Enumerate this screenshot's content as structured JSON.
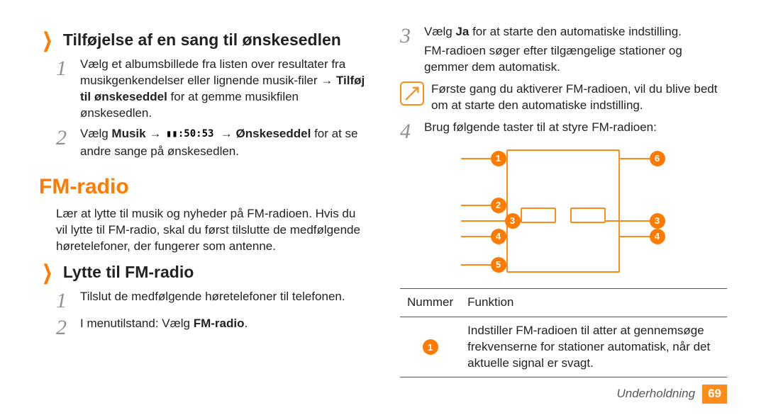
{
  "left": {
    "h2a": "Tilføjelse af en sang til ønskesedlen",
    "step1": "Vælg et albumsbillede fra listen over resultater fra musikgenkendelser eller lignende musik-filer → ",
    "step1_bold": "Tilføj til ønskeseddel",
    "step1_tail": " for at gemme musikfilen ønskesedlen.",
    "step2_pre": "Vælg ",
    "step2_b1": "Musik",
    "step2_mid": " → ",
    "step2_b2": " → Ønskeseddel",
    "step2_tail": " for at se andre sange på ønskesedlen.",
    "h1": "FM-radio",
    "intro": "Lær at lytte til musik og nyheder på FM-radioen. Hvis du vil lytte til FM-radio, skal du først tilslutte de medfølgende høretelefoner, der fungerer som antenne.",
    "h2b": "Lytte til FM-radio",
    "stepB1": "Tilslut de medfølgende høretelefoner til telefonen.",
    "stepB2_pre": "I menutilstand: Vælg ",
    "stepB2_b": "FM-radio",
    "stepB2_tail": "."
  },
  "right": {
    "step3_pre": "Vælg ",
    "step3_b": "Ja",
    "step3_mid": " for at starte den automatiske indstilling.",
    "step3_p2": "FM-radioen søger efter tilgængelige stationer og gemmer dem automatisk.",
    "note": "Første gang du aktiverer FM-radioen, vil du blive bedt om at starte den automatiske indstilling.",
    "step4": "Brug følgende taster til at styre FM-radioen:",
    "th1": "Nummer",
    "th2": "Funktion",
    "row1": "Indstiller FM-radioen til atter at gennemsøge frekvenserne for stationer automatisk, når det aktuelle signal er svagt."
  },
  "footer": {
    "section": "Underholdning",
    "page": "69"
  }
}
